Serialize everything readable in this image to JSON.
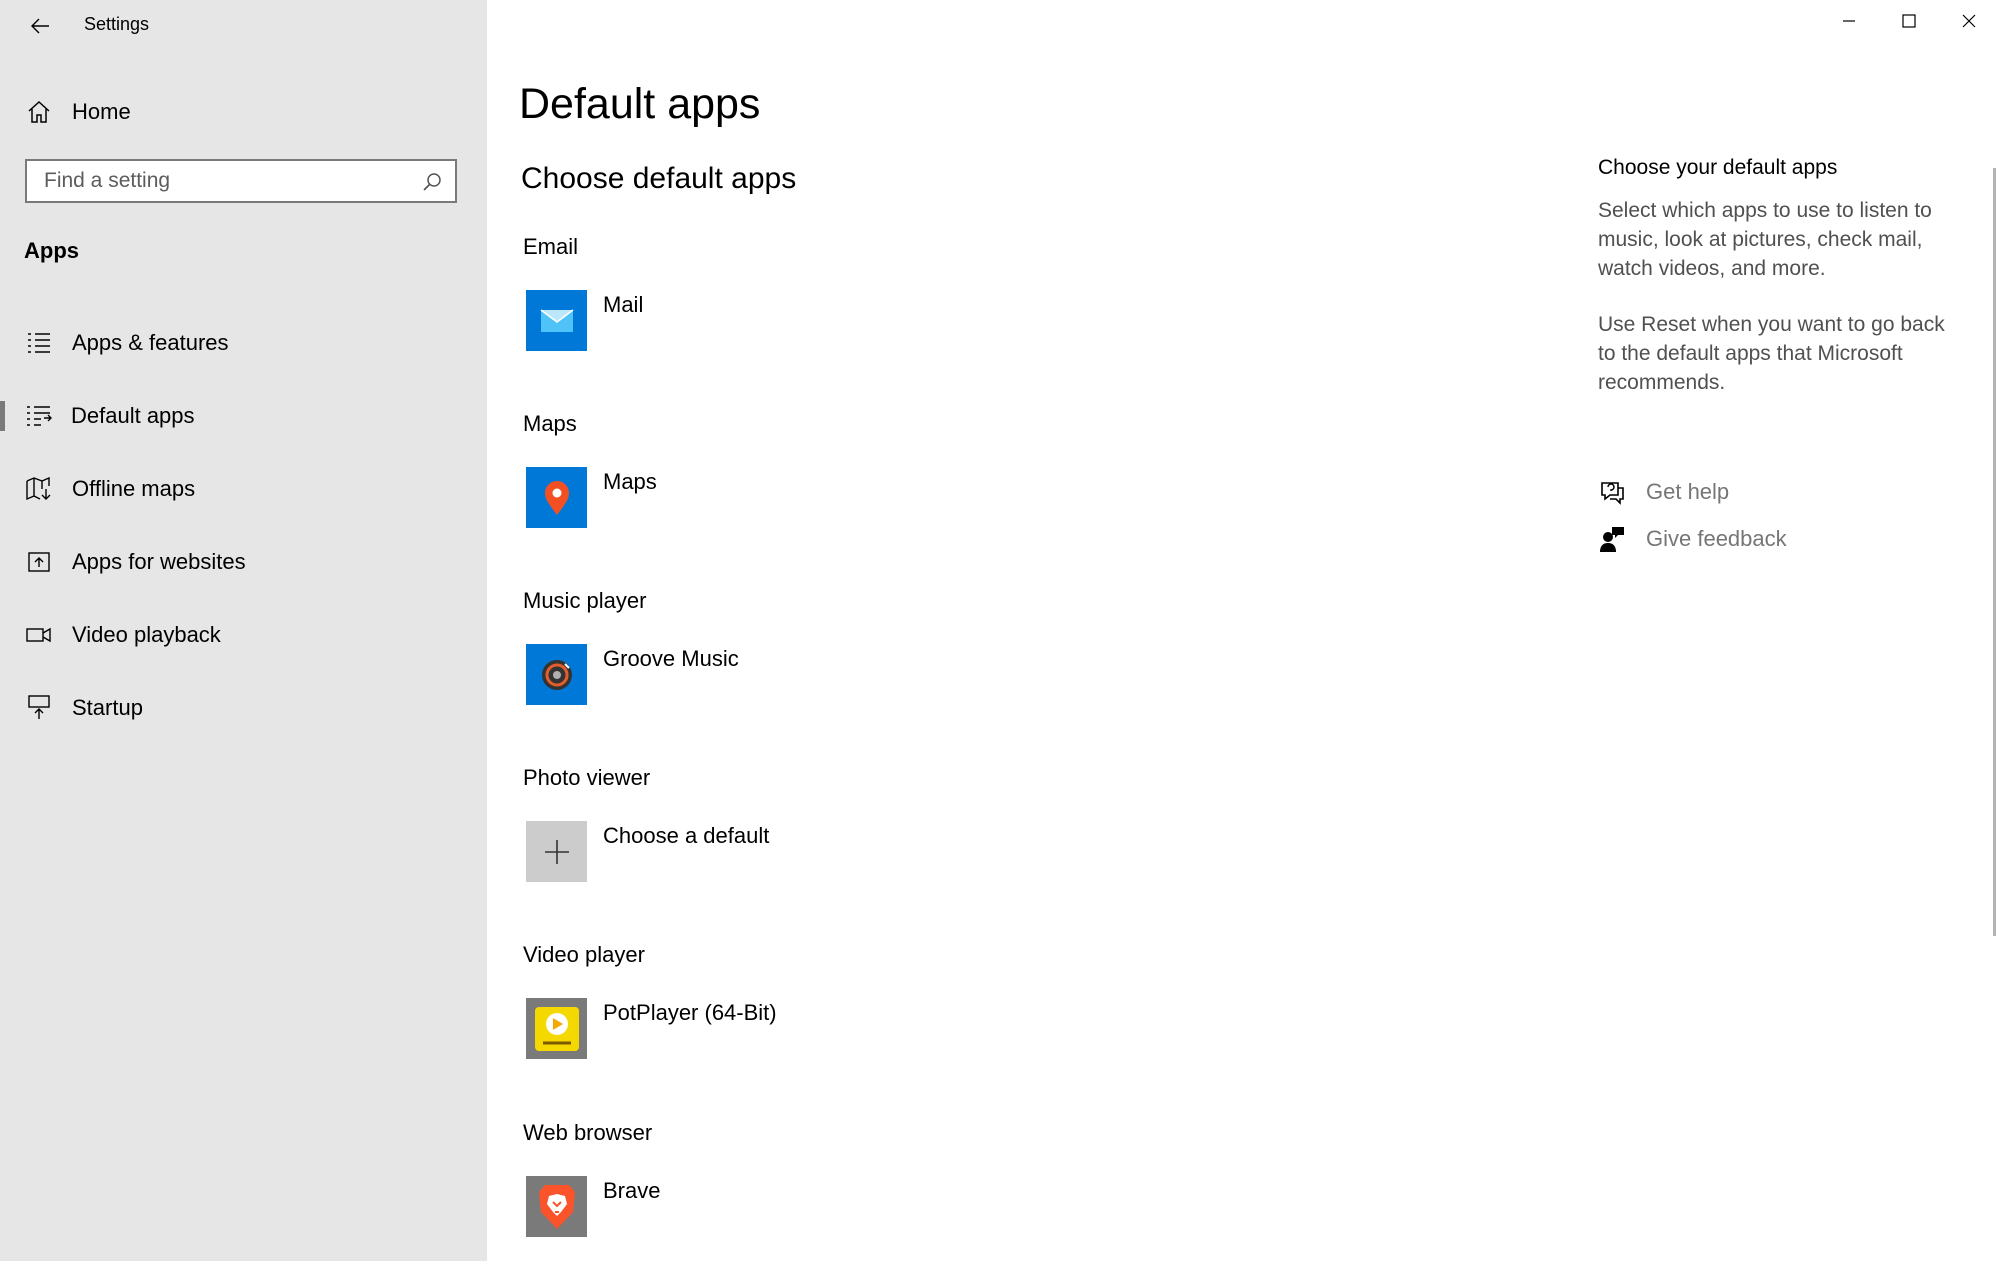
{
  "window": {
    "title": "Settings"
  },
  "sidebar": {
    "home_label": "Home",
    "search_placeholder": "Find a setting",
    "section_heading": "Apps",
    "items": [
      {
        "label": "Apps & features",
        "icon": "list-icon"
      },
      {
        "label": "Default apps",
        "icon": "default-apps-icon",
        "active": true
      },
      {
        "label": "Offline maps",
        "icon": "map-download-icon"
      },
      {
        "label": "Apps for websites",
        "icon": "open-external-icon"
      },
      {
        "label": "Video playback",
        "icon": "video-camera-icon"
      },
      {
        "label": "Startup",
        "icon": "startup-icon"
      }
    ]
  },
  "main": {
    "title": "Default apps",
    "subtitle": "Choose default apps",
    "categories": [
      {
        "label": "Email",
        "app": "Mail",
        "icon": "mail-icon",
        "tile_color": "#0078d7"
      },
      {
        "label": "Maps",
        "app": "Maps",
        "icon": "map-pin-icon",
        "tile_color": "#0078d7"
      },
      {
        "label": "Music player",
        "app": "Groove Music",
        "icon": "groove-music-icon",
        "tile_color": "#0078d7"
      },
      {
        "label": "Photo viewer",
        "app": "Choose a default",
        "icon": "plus-icon",
        "tile_color": "#cccccc"
      },
      {
        "label": "Video player",
        "app": "PotPlayer (64-Bit)",
        "icon": "potplayer-icon",
        "tile_color": "#7a7a7a"
      },
      {
        "label": "Web browser",
        "app": "Brave",
        "icon": "brave-lion-icon",
        "tile_color": "#7a7a7a"
      }
    ]
  },
  "help": {
    "title": "Choose your default apps",
    "para1": "Select which apps to use to listen to music, look at pictures, check mail, watch videos, and more.",
    "para2": "Use Reset when you want to go back to the default apps that Microsoft recommends.",
    "get_help": "Get help",
    "give_feedback": "Give feedback"
  },
  "colors": {
    "sidebar_bg": "#e6e6e6",
    "accent": "#0078d7",
    "link_gray": "#767676"
  }
}
